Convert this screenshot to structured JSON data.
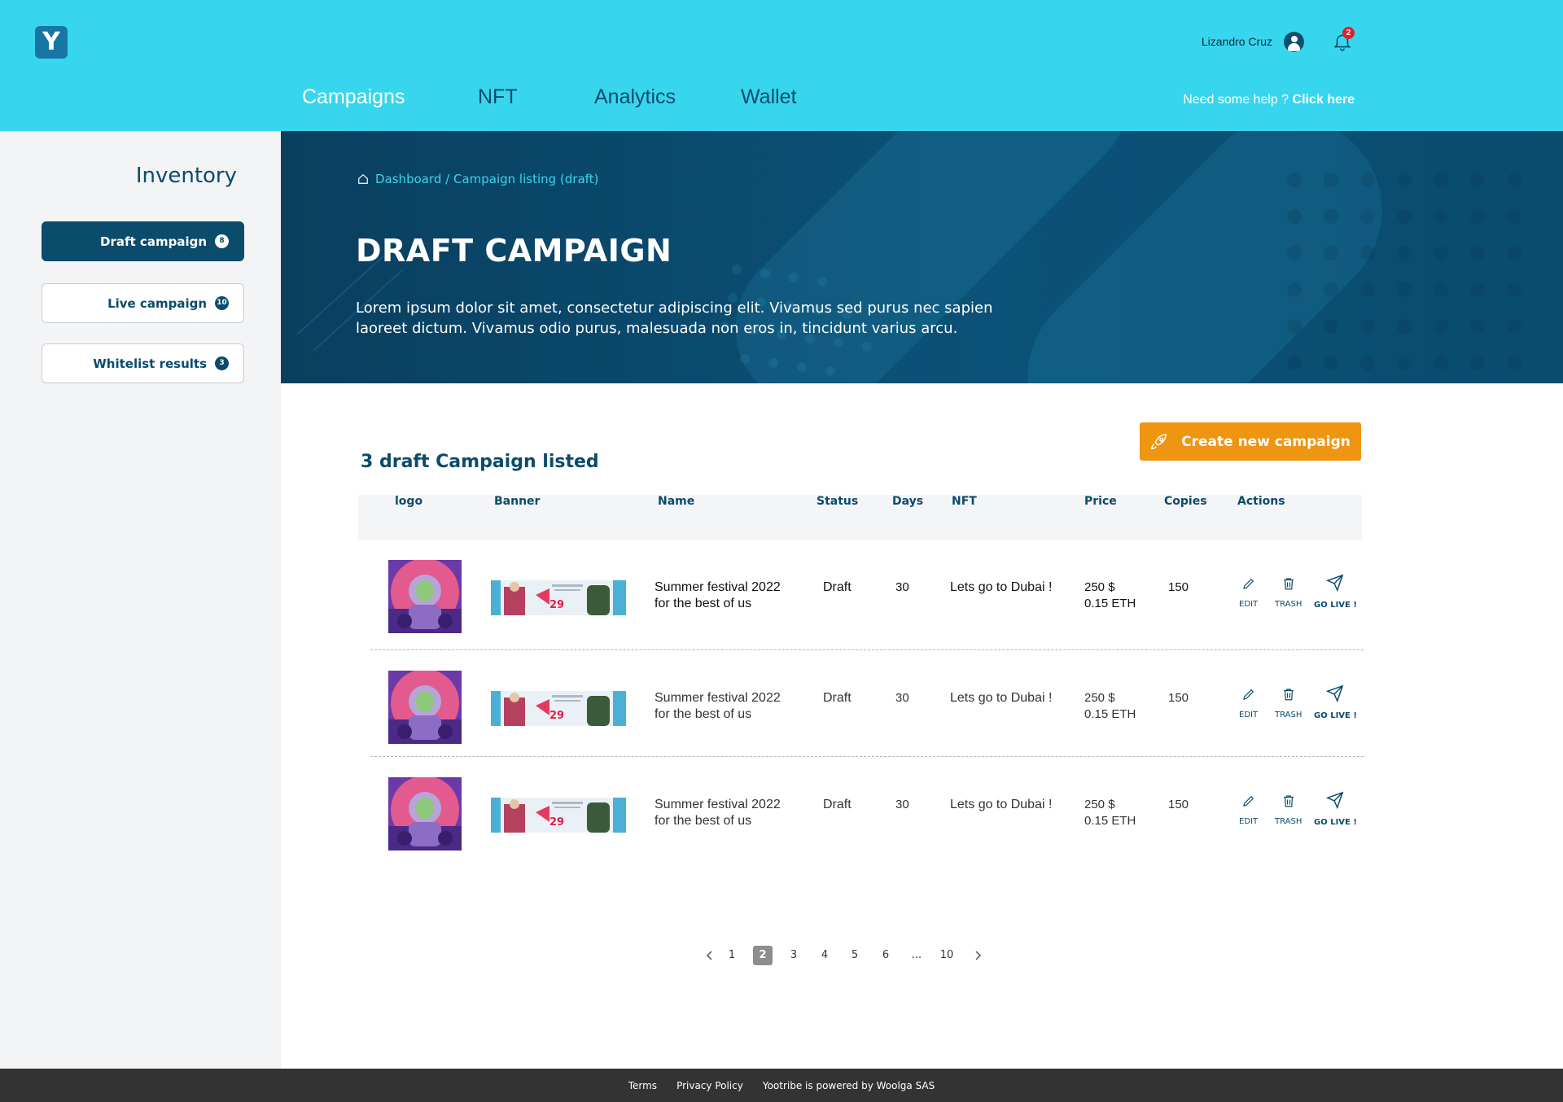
{
  "header": {
    "logo_letter": "Y",
    "user_name": "Lizandro Cruz",
    "notification_count": "2",
    "nav": [
      {
        "label": "Campaigns",
        "active": true
      },
      {
        "label": "NFT",
        "active": false
      },
      {
        "label": "Analytics",
        "active": false
      },
      {
        "label": "Wallet",
        "active": false
      }
    ],
    "help_text": "Need some help ?",
    "help_link": "Click here"
  },
  "sidebar": {
    "title": "Inventory",
    "items": [
      {
        "label": "Draft campaign",
        "count": "8",
        "active": true
      },
      {
        "label": "Live campaign",
        "count": "10",
        "active": false
      },
      {
        "label": "Whitelist results",
        "count": "3",
        "active": false
      }
    ]
  },
  "hero": {
    "breadcrumb": "Dashboard / Campaign listing (draft)",
    "title": "DRAFT CAMPAIGN",
    "description": "Lorem ipsum dolor sit amet, consectetur adipiscing elit. Vivamus sed purus nec sapien laoreet dictum. Vivamus odio purus, malesuada non eros in, tincidunt varius arcu."
  },
  "content": {
    "list_title": "3 draft Campaign listed",
    "create_button": "Create new campaign",
    "columns": [
      "logo",
      "Banner",
      "Name",
      "Status",
      "Days",
      "NFT",
      "Price",
      "Copies",
      "Actions"
    ],
    "rows": [
      {
        "name_line1": "Summer festival 2022",
        "name_line2": "for the best of us",
        "status": "Draft",
        "days": "30",
        "nft": "Lets go to Dubai !",
        "price_usd": "250 $",
        "price_eth": "0.15 ETH",
        "copies": "150",
        "banner_price": "29"
      },
      {
        "name_line1": "Summer festival 2022",
        "name_line2": "for the best of us",
        "status": "Draft",
        "days": "30",
        "nft": "Lets go to Dubai !",
        "price_usd": "250 $",
        "price_eth": "0.15 ETH",
        "copies": "150",
        "banner_price": "29"
      },
      {
        "name_line1": "Summer festival 2022",
        "name_line2": "for the best of us",
        "status": "Draft",
        "days": "30",
        "nft": "Lets go to Dubai !",
        "price_usd": "250 $",
        "price_eth": "0.15 ETH",
        "copies": "150",
        "banner_price": "29"
      }
    ],
    "actions": {
      "edit": "EDIT",
      "trash": "TRASH",
      "go_live": "GO LIVE !"
    }
  },
  "pagination": {
    "pages": [
      "1",
      "2",
      "3",
      "4",
      "5",
      "6",
      "...",
      "10"
    ],
    "current": "2"
  },
  "footer": {
    "terms": "Terms",
    "privacy": "Privacy Policy",
    "powered": "Yootribe is powered by Woolga SAS"
  },
  "colors": {
    "header_bg": "#38d6ee",
    "primary": "#0b4b6b",
    "accent_orange": "#ee9512",
    "footer_bg": "#333333",
    "sidebar_bg": "#f3f4f6"
  }
}
